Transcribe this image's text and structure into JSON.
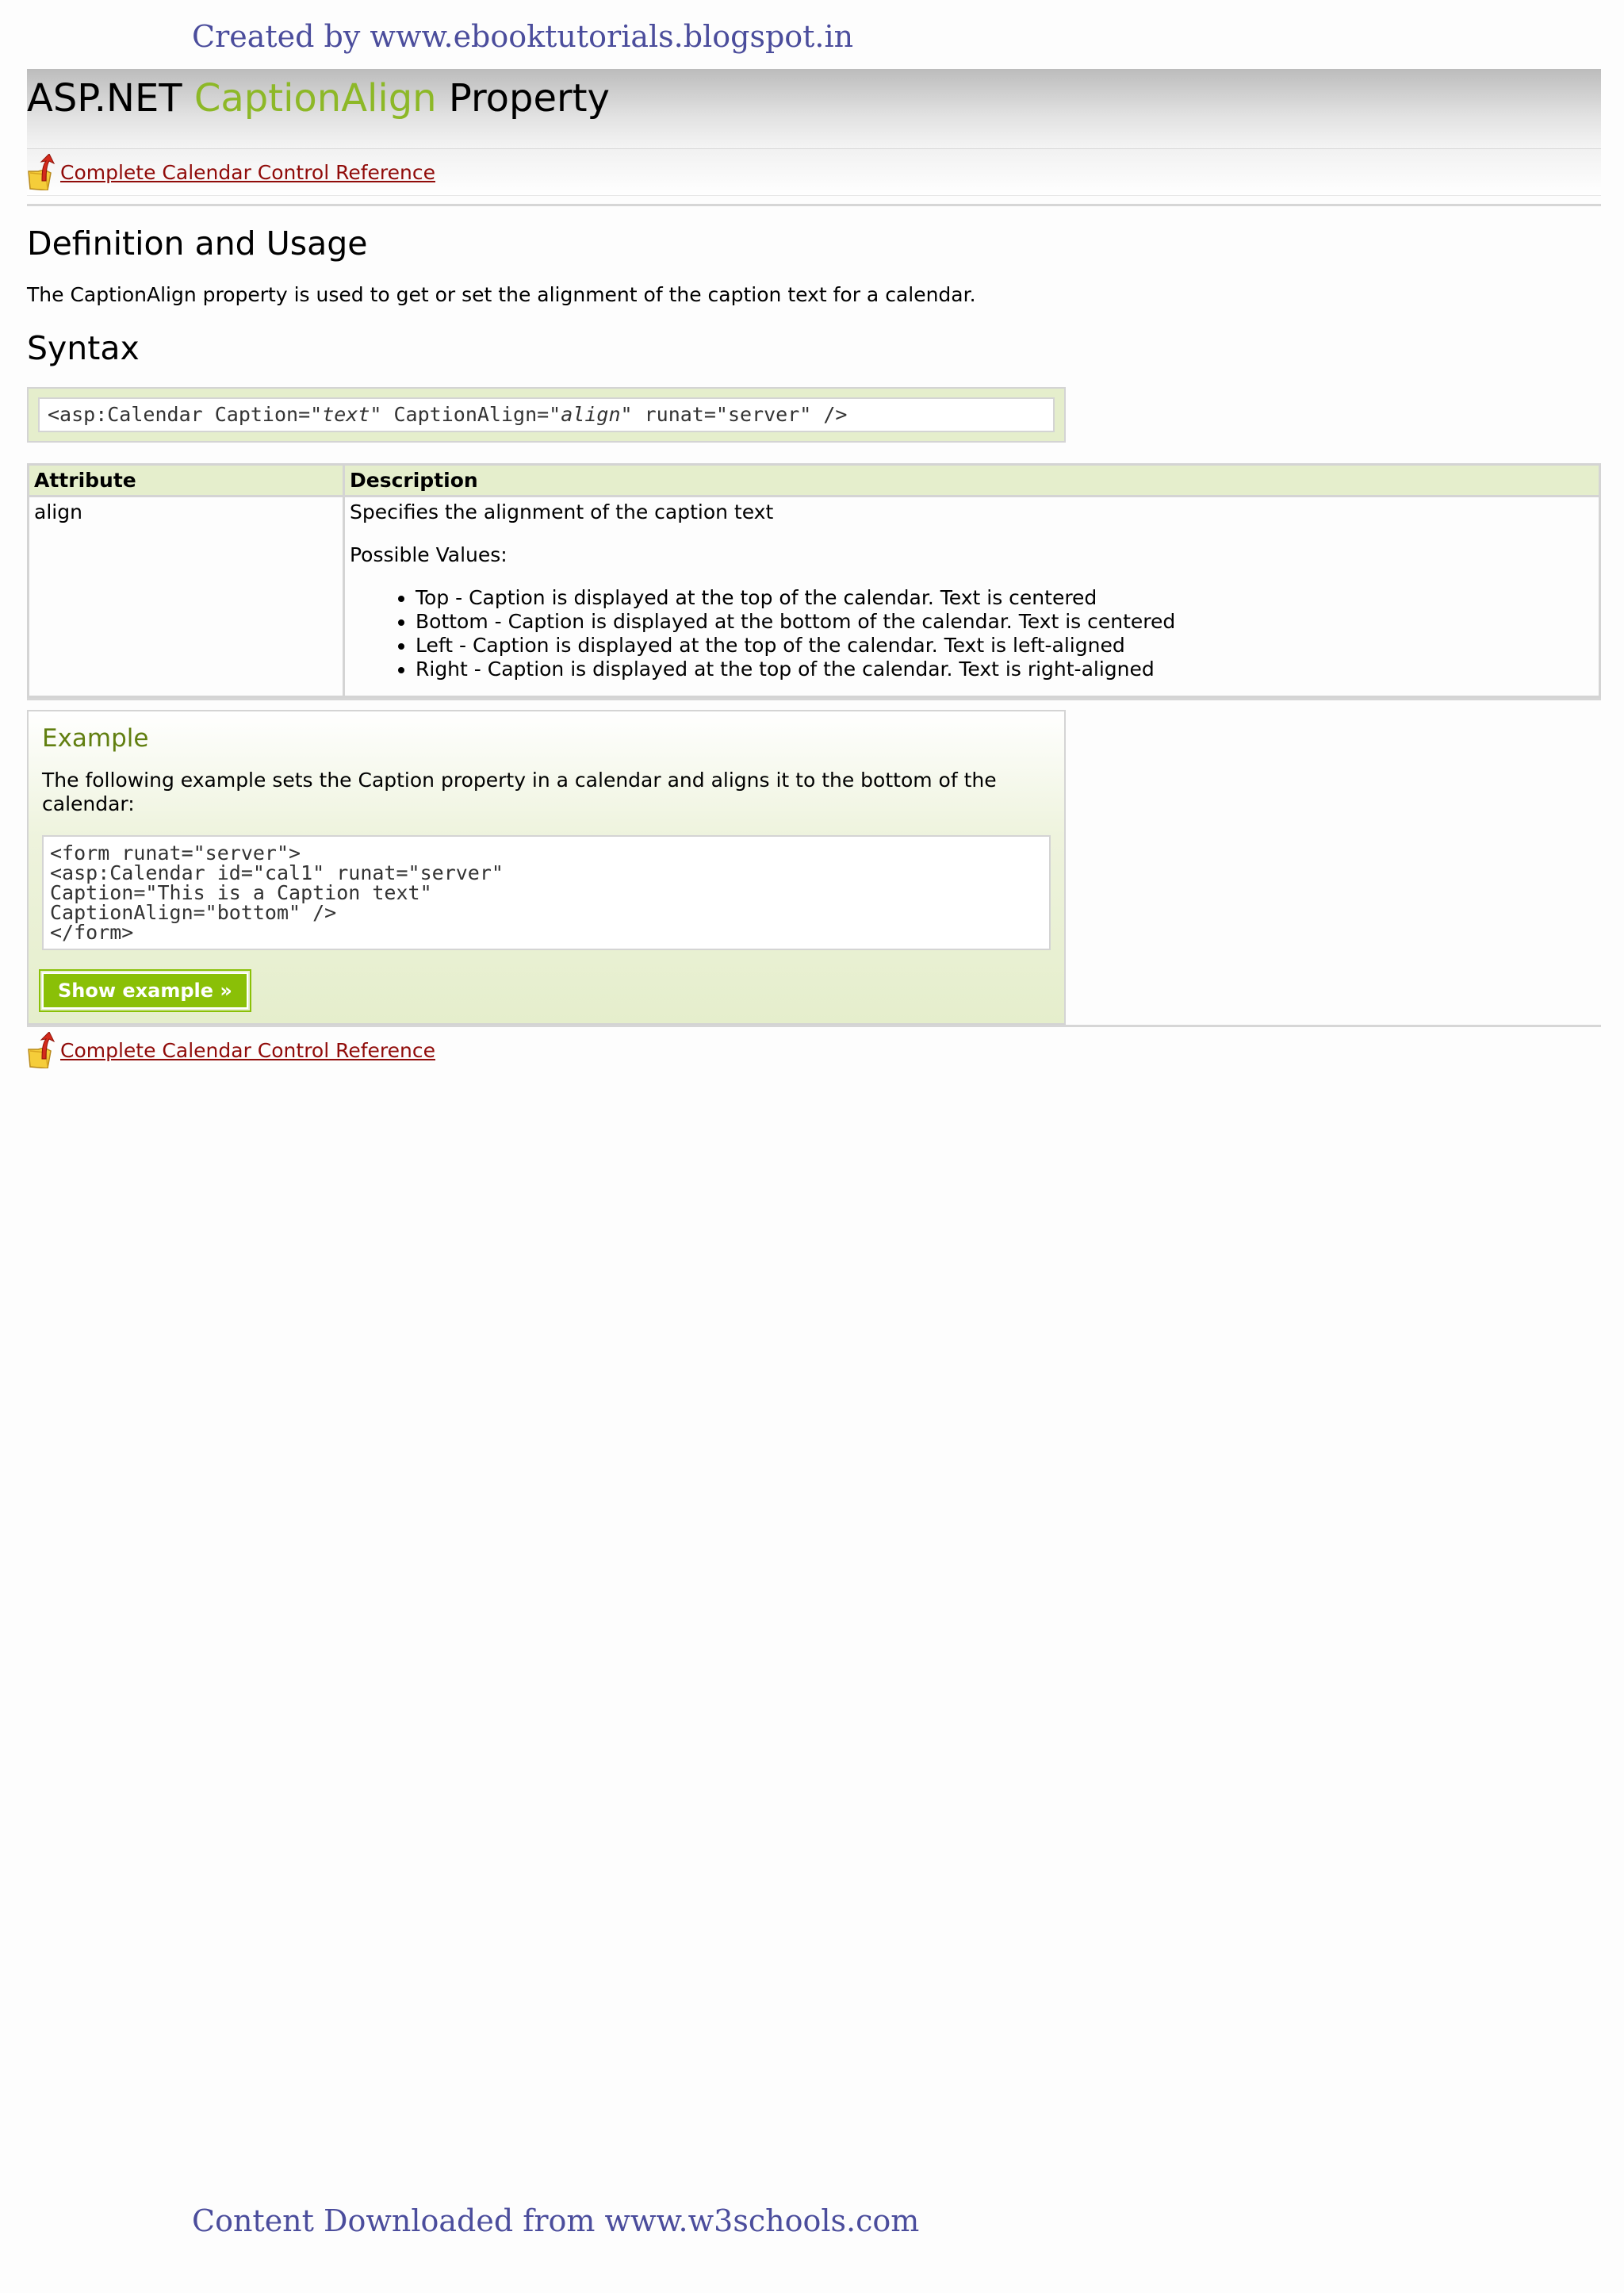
{
  "watermark": {
    "top": "Created by www.ebooktutorials.blogspot.in",
    "bottom": "Content Downloaded from www.w3schools.com"
  },
  "title": {
    "prefix": "ASP.NET ",
    "highlight": "CaptionAlign",
    "suffix": " Property"
  },
  "nav": {
    "ref_link": " Complete Calendar Control Reference"
  },
  "definition": {
    "heading": "Definition and Usage",
    "text": "The CaptionAlign property is used to get or set the alignment of the caption text for a calendar."
  },
  "syntax": {
    "heading": "Syntax",
    "part1": "<asp:Calendar Caption=\"",
    "arg1": "text",
    "part2": "\" CaptionAlign=\"",
    "arg2": "align",
    "part3": "\" runat=\"server\" />"
  },
  "table": {
    "headers": [
      "Attribute",
      "Description"
    ],
    "attribute": "align",
    "description": "Specifies the alignment of the caption text",
    "possible_label": "Possible Values:",
    "values": [
      "Top - Caption is displayed at the top of the calendar. Text is centered",
      "Bottom - Caption is displayed at the bottom of the calendar. Text is centered",
      "Left - Caption is displayed at the top of the calendar. Text is left-aligned",
      "Right - Caption is displayed at the top of the calendar. Text is right-aligned"
    ]
  },
  "example": {
    "heading": "Example",
    "text": "The following example sets the Caption property in a calendar and aligns it to the bottom of the calendar:",
    "code": [
      "<form runat=\"server\">",
      "<asp:Calendar id=\"cal1\" runat=\"server\"",
      "Caption=\"This is a Caption text\"",
      "CaptionAlign=\"bottom\" />",
      "</form>"
    ],
    "button": "Show example »"
  },
  "colors": {
    "accent_green": "#8db827",
    "link_red": "#900b09",
    "watermark_blue": "#4b4d9c",
    "panel_green": "#e5eecc"
  },
  "icons": {
    "ref_link_icon": "folder-up-arrow-icon"
  }
}
